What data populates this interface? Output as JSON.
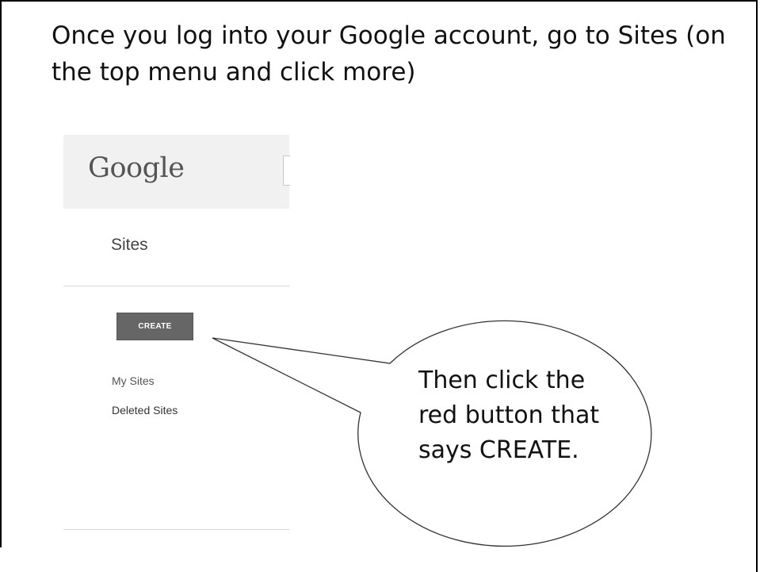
{
  "slide": {
    "instruction": "Once you log into your Google account, go to Sites (on the top menu and click more)"
  },
  "screenshot": {
    "logo_text": "Google",
    "page_title": "Sites",
    "create_button_label": "CREATE",
    "nav_items": [
      {
        "label": "My Sites"
      },
      {
        "label": "Deleted Sites"
      }
    ]
  },
  "callout": {
    "text": "Then click the red button that says CREATE."
  },
  "colors": {
    "create_button": "#666666",
    "header_background": "#f1f1f1",
    "slide_border": "#000000"
  }
}
